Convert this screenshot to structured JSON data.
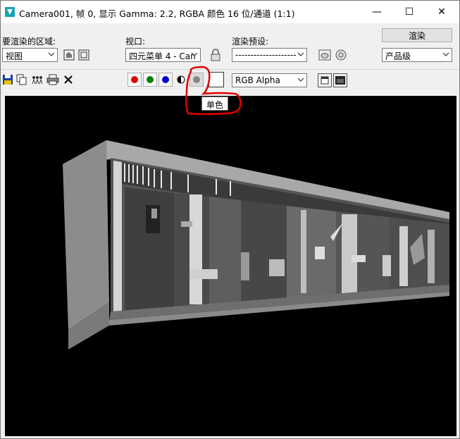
{
  "window": {
    "title": "Camera001, 帧 0, 显示 Gamma: 2.2, RGBA 颜色 16 位/通道 (1:1)",
    "controls": {
      "minimize": "—",
      "maximize": "☐",
      "close": "✕"
    }
  },
  "toolbar": {
    "area_label": "要渲染的区域:",
    "area_value": "视图",
    "viewport_label": "视口:",
    "viewport_value": "四元菜单 4 - Can",
    "preset_label": "渲染预设:",
    "preset_value": "--------------------",
    "render_button": "渲染",
    "quality_value": "产品级",
    "channel_value": "RGB Alpha"
  },
  "tooltip": {
    "text": "单色"
  },
  "colors": {
    "red_channel": "#e00000",
    "green_channel": "#008000",
    "blue_channel": "#0000d0",
    "mono": "#888888",
    "annotation": "#e00000"
  }
}
